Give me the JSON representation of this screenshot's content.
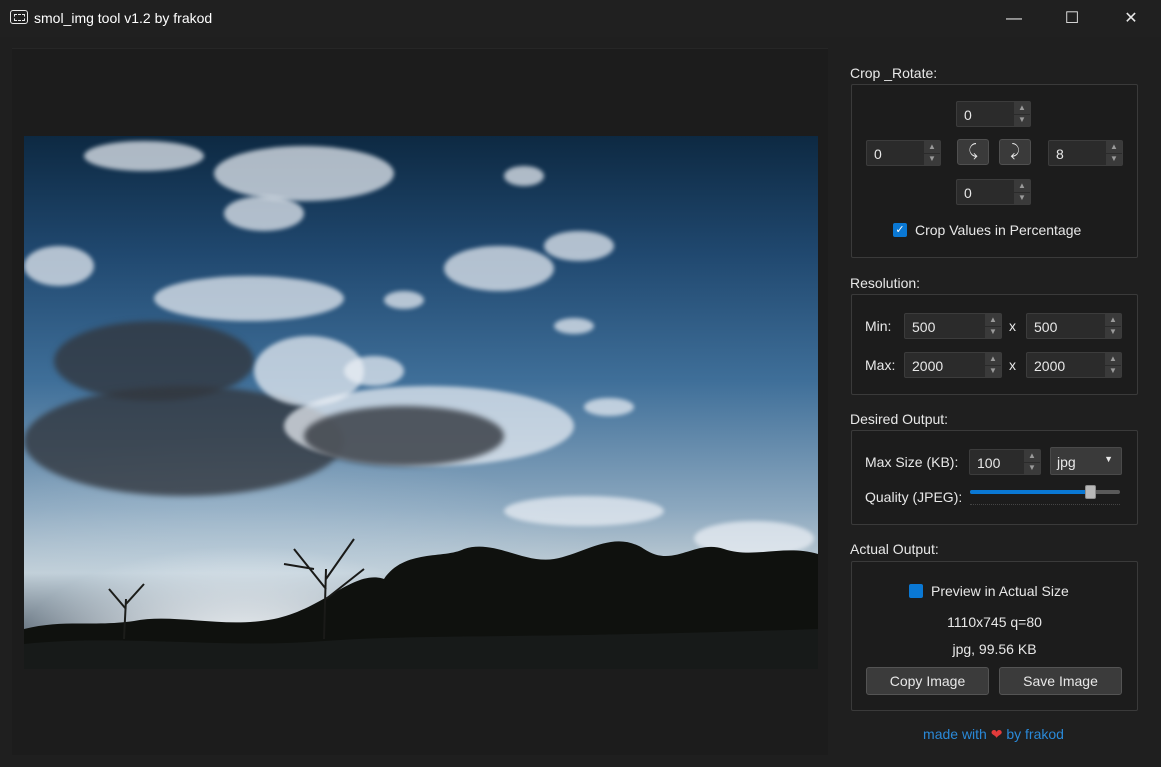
{
  "window": {
    "title": "smol_img tool v1.2 by frakod",
    "minimize": "—",
    "maximize": "☐",
    "close": "✕"
  },
  "crop_rotate": {
    "label": "Crop _Rotate:",
    "top": "0",
    "left": "0",
    "right": "8",
    "bottom": "0",
    "rotate_left_icon": "⤹",
    "rotate_right_icon": "⤸",
    "crop_percentage_checked": true,
    "crop_percentage_label": "Crop Values in Percentage"
  },
  "resolution": {
    "label": "Resolution:",
    "min_label": "Min:",
    "max_label": "Max:",
    "x_label": "x",
    "min_w": "500",
    "min_h": "500",
    "max_w": "2000",
    "max_h": "2000"
  },
  "desired_output": {
    "label": "Desired Output:",
    "max_size_label": "Max Size (KB):",
    "max_size": "100",
    "format": "jpg",
    "quality_label": "Quality (JPEG):",
    "quality_fraction": 0.8
  },
  "actual_output": {
    "label": "Actual Output:",
    "preview_checked": true,
    "preview_label": "Preview in Actual Size",
    "dimensions": "1110x745 q=80",
    "file_info": "jpg, 99.56 KB",
    "copy_button": "Copy Image",
    "save_button": "Save Image"
  },
  "footer": {
    "prefix": "made with",
    "heart": "❤",
    "suffix": "by frakod"
  },
  "colors": {
    "accent": "#0a78d4",
    "link": "#2a89d8",
    "heart": "#e23b3b"
  }
}
